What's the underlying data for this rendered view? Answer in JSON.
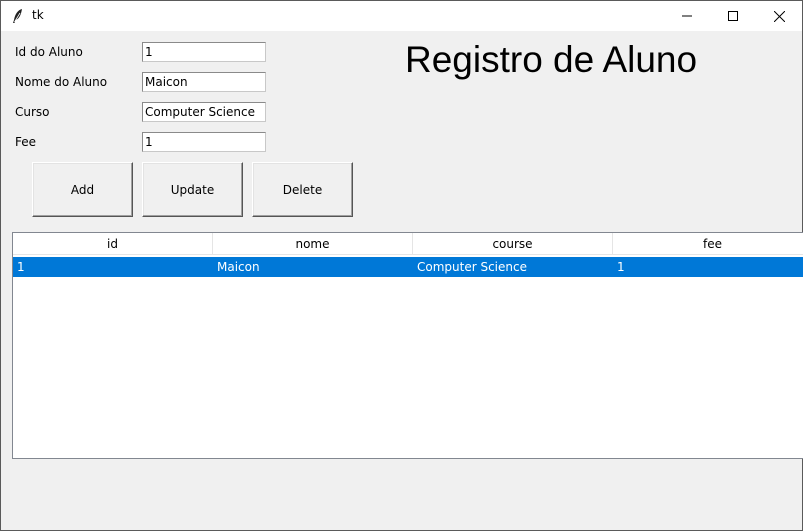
{
  "window": {
    "title": "tk",
    "icon": "feather-icon"
  },
  "form": {
    "fields": [
      {
        "label": "Id do Aluno",
        "value": "1"
      },
      {
        "label": "Nome do Aluno",
        "value": "Maicon"
      },
      {
        "label": "Curso",
        "value": "Computer Science"
      },
      {
        "label": "Fee",
        "value": "1"
      }
    ]
  },
  "heading": "Registro de Aluno",
  "buttons": {
    "add": "Add",
    "update": "Update",
    "delete": "Delete"
  },
  "table": {
    "columns": [
      "id",
      "nome",
      "course",
      "fee"
    ],
    "rows": [
      {
        "cells": [
          "1",
          "Maicon",
          "Computer Science",
          "1"
        ],
        "selected": true
      }
    ]
  },
  "colors": {
    "selection": "#0078d7",
    "background": "#f0f0f0"
  }
}
